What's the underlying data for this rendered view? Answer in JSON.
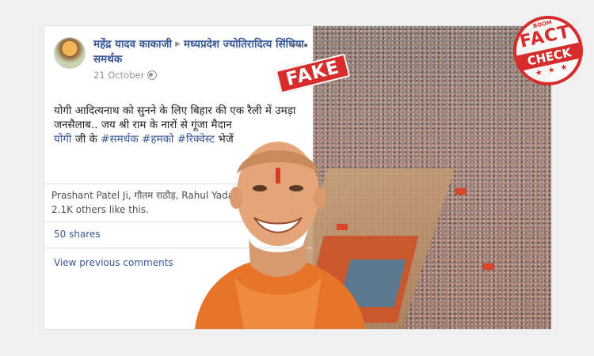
{
  "post": {
    "author": "महेंद्र यादव काकाजी",
    "group": "मध्यप्रदेश ज्योतिरादित्य सिंधिया समर्थक",
    "date": "21 October",
    "text_line1": "योगी आदित्यनाथ को सुनने के लिए बिहार की एक रैली में उमड़ा जनसैलाब.. जय श्री राम के नारों से गूंजा मैदान",
    "text_link1": "योगी",
    "text_mid": " जी के ",
    "text_link2": "#समर्थक",
    "text_link3": "#हमको",
    "text_link4": "#रिक्वेस्ट",
    "text_end": " भेजें",
    "likes": "Prashant Patel Ji, गौतम राठौड़, Rahul Yadav and 2.1K others like this.",
    "shares": "50 shares",
    "view_comments": "View previous comments"
  },
  "stamps": {
    "fake": "FAKE",
    "boom": "BOOM",
    "fact": "FACT",
    "check": "CHECK",
    "stars": "★ ★ ★"
  },
  "colors": {
    "link": "#385898",
    "stamp_red": "#d62c2c",
    "robe": "#e8742a"
  },
  "icons": [
    "globe-icon",
    "more-options-icon",
    "group-arrow-icon"
  ]
}
